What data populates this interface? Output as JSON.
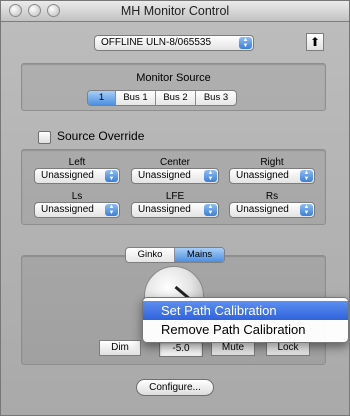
{
  "window": {
    "title": "MH Monitor Control"
  },
  "device": {
    "selected": "OFFLINE ULN-8/065535",
    "eject_icon": "up-arrow-icon"
  },
  "monitor_source": {
    "label": "Monitor Source",
    "options": [
      "1",
      "Bus 1",
      "Bus 2",
      "Bus 3"
    ],
    "selected": "1"
  },
  "source_override": {
    "label": "Source Override",
    "checked": false
  },
  "channels": [
    {
      "label": "Left",
      "value": "Unassigned"
    },
    {
      "label": "Center",
      "value": "Unassigned"
    },
    {
      "label": "Right",
      "value": "Unassigned"
    },
    {
      "label": "Ls",
      "value": "Unassigned"
    },
    {
      "label": "LFE",
      "value": "Unassigned"
    },
    {
      "label": "Rs",
      "value": "Unassigned"
    }
  ],
  "output_tabs": {
    "options": [
      "Ginko",
      "Mains"
    ],
    "selected": "Mains"
  },
  "controls": {
    "dim_label": "Dim",
    "level_value": "-5.0",
    "mute_label": "Mute",
    "lock_label": "Lock"
  },
  "context_menu": {
    "items": [
      "Set Path Calibration",
      "Remove Path Calibration"
    ],
    "highlighted": "Set Path Calibration"
  },
  "footer": {
    "configure_label": "Configure..."
  },
  "colors": {
    "accent": "#3a7fda",
    "menu_highlight": "#2f63dc"
  }
}
